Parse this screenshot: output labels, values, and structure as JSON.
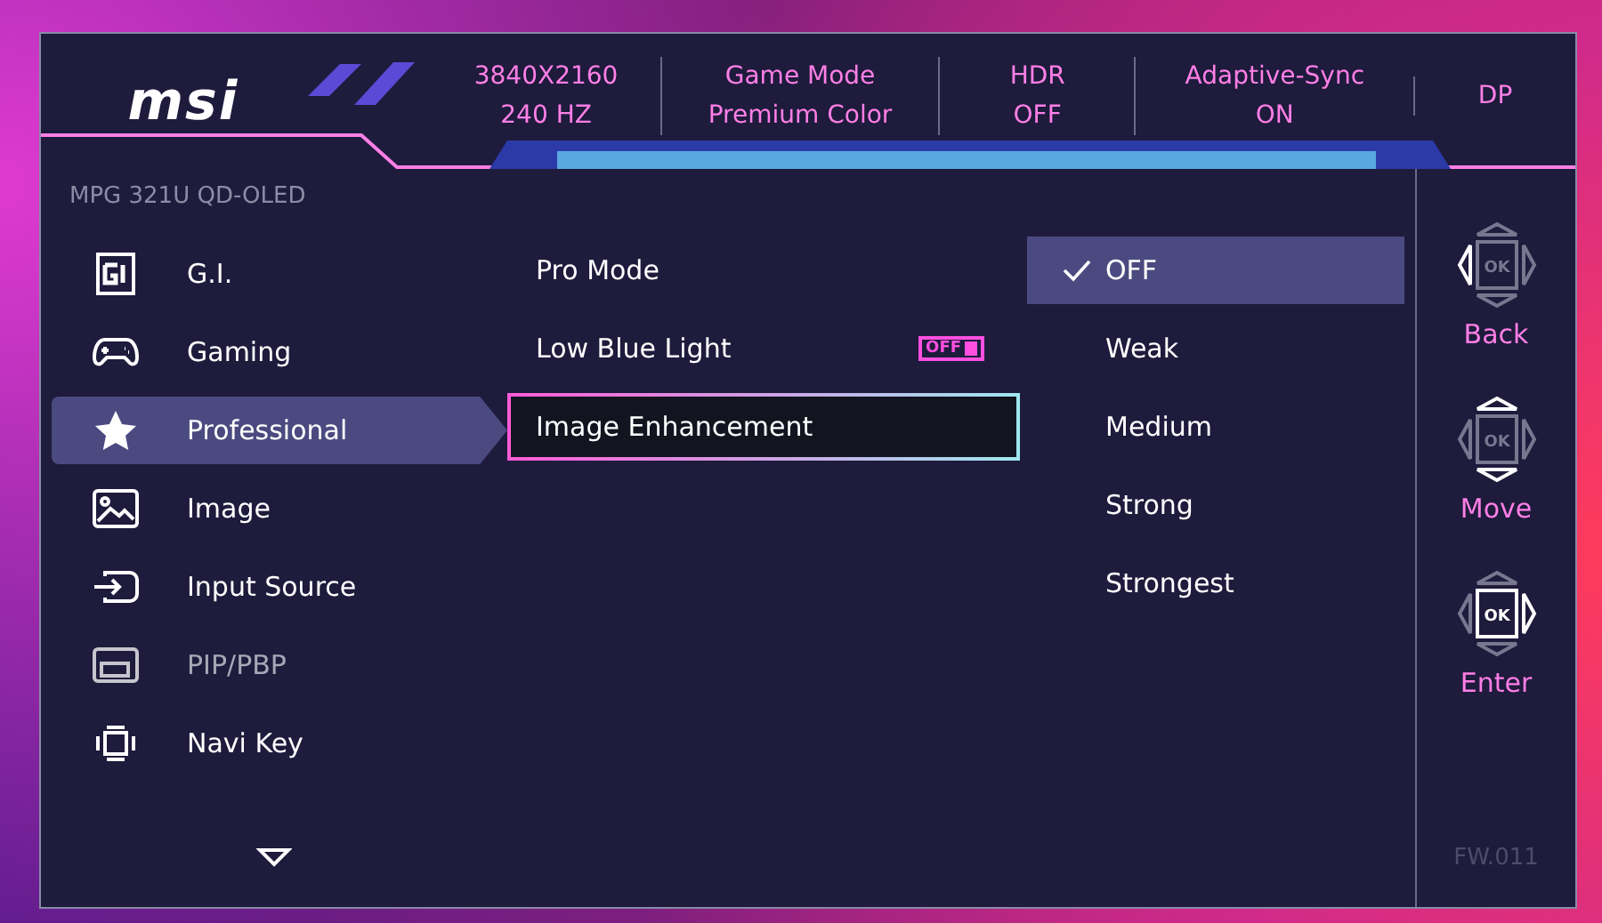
{
  "header": {
    "logo": "msi",
    "info": [
      {
        "line1": "3840X2160",
        "line2": "240 HZ"
      },
      {
        "line1": "Game Mode",
        "line2": "Premium Color"
      },
      {
        "line1": "HDR",
        "line2": "OFF"
      },
      {
        "line1": "Adaptive-Sync",
        "line2": "ON"
      },
      {
        "line1": "DP"
      }
    ]
  },
  "model": "MPG 321U QD-OLED",
  "menu": [
    {
      "label": "G.I.",
      "kind": "gi",
      "selected": false,
      "disabled": false
    },
    {
      "label": "Gaming",
      "kind": "gamepad",
      "selected": false,
      "disabled": false
    },
    {
      "label": "Professional",
      "kind": "star",
      "selected": true,
      "disabled": false
    },
    {
      "label": "Image",
      "kind": "image",
      "selected": false,
      "disabled": false
    },
    {
      "label": "Input Source",
      "kind": "input",
      "selected": false,
      "disabled": false
    },
    {
      "label": "PIP/PBP",
      "kind": "pip",
      "selected": false,
      "disabled": true
    },
    {
      "label": "Navi Key",
      "kind": "navi",
      "selected": false,
      "disabled": false
    }
  ],
  "submenu": [
    {
      "label": "Pro Mode",
      "selected": false
    },
    {
      "label": "Low Blue Light",
      "badge": "OFF",
      "selected": false
    },
    {
      "label": "Image Enhancement",
      "selected": true
    }
  ],
  "options": [
    {
      "label": "OFF",
      "checked": true,
      "selected": true
    },
    {
      "label": "Weak",
      "checked": false,
      "selected": false
    },
    {
      "label": "Medium",
      "checked": false,
      "selected": false
    },
    {
      "label": "Strong",
      "checked": false,
      "selected": false
    },
    {
      "label": "Strongest",
      "checked": false,
      "selected": false
    }
  ],
  "navigation": [
    {
      "label": "Back",
      "key": "OK",
      "kind": "left"
    },
    {
      "label": "Move",
      "key": "OK",
      "kind": "updown"
    },
    {
      "label": "Enter",
      "key": "OK",
      "kind": "okright"
    }
  ],
  "firmware": "FW.011"
}
